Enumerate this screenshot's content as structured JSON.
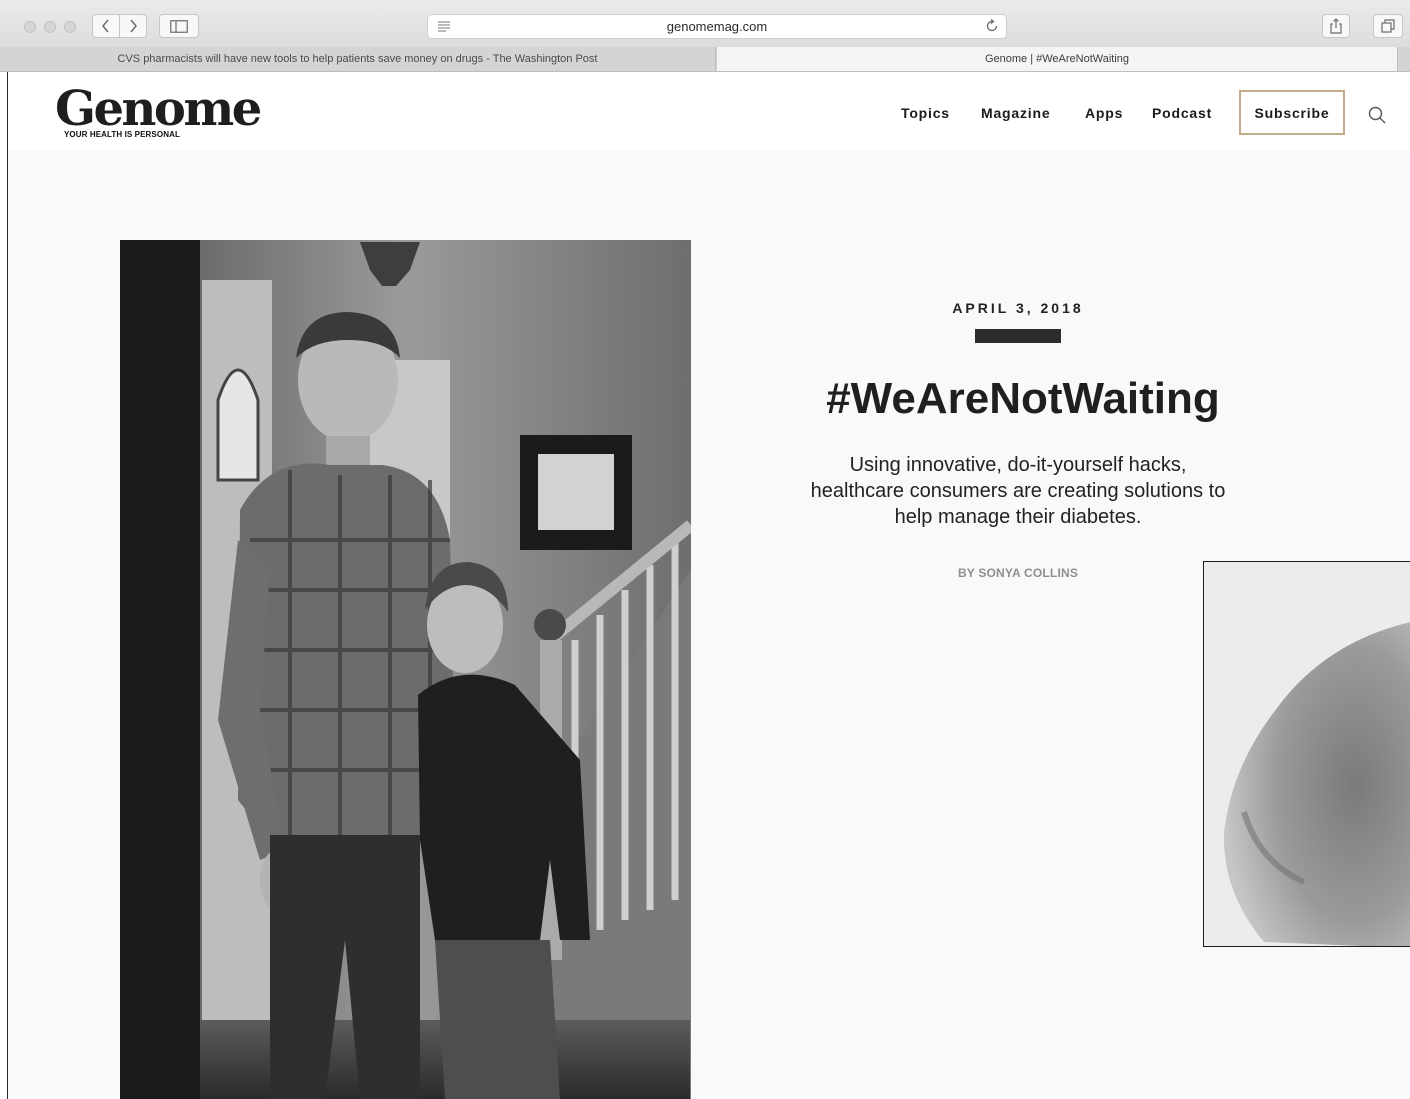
{
  "browser": {
    "address": "genomemag.com",
    "tabs": [
      {
        "title": "CVS pharmacists will have new tools to help patients save money on drugs - The Washington Post",
        "active": false
      },
      {
        "title": "Genome | #WeAreNotWaiting",
        "active": true
      }
    ]
  },
  "site": {
    "logo": "Genome",
    "tagline": "YOUR HEALTH IS PERSONAL",
    "nav": [
      "Topics",
      "Magazine",
      "Apps",
      "Podcast"
    ],
    "subscribe_label": "Subscribe",
    "accent_color": "#c2ab8b"
  },
  "article": {
    "date": "APRIL 3, 2018",
    "title": "#WeAreNotWaiting",
    "dek": "Using innovative, do-it-yourself hacks, healthcare consumers are creating solutions to help manage their diabetes.",
    "byline": "BY SONYA COLLINS"
  },
  "icons": [
    "back-icon",
    "forward-icon",
    "sidebar-icon",
    "reader-icon",
    "reload-icon",
    "share-icon",
    "tabs-icon",
    "search-icon"
  ]
}
